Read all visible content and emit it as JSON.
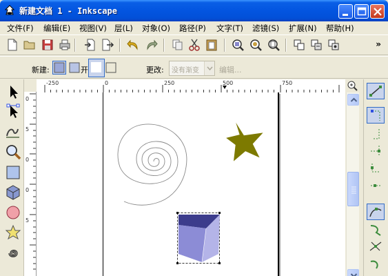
{
  "window": {
    "title": "新建文档 1 - Inkscape"
  },
  "menu": [
    {
      "label": "文件(F)"
    },
    {
      "label": "编辑(E)"
    },
    {
      "label": "视图(V)"
    },
    {
      "label": "层(L)"
    },
    {
      "label": "对象(O)"
    },
    {
      "label": "路径(P)"
    },
    {
      "label": "文字(T)"
    },
    {
      "label": "滤镜(S)"
    },
    {
      "label": "扩展(N)"
    },
    {
      "label": "帮助(H)"
    }
  ],
  "toolbar": {
    "more_label": "»"
  },
  "tool_controls": {
    "new_label": "新建:",
    "open_label": "开",
    "change_label": "更改:",
    "gradient_combo_value": "没有渐变",
    "edit_label": "编辑..."
  },
  "ruler": {
    "top_labels": [
      "-250",
      "0",
      "250",
      "500",
      "750"
    ],
    "left_labels": [
      "0",
      "5",
      "0",
      "0",
      "5"
    ]
  },
  "colors": {
    "star": "#7D7A00",
    "cube_top": "#3C3C8C",
    "cube_left": "#8C8CD6",
    "cube_right": "#B4B4E8",
    "accent": "#0A5FE6"
  }
}
